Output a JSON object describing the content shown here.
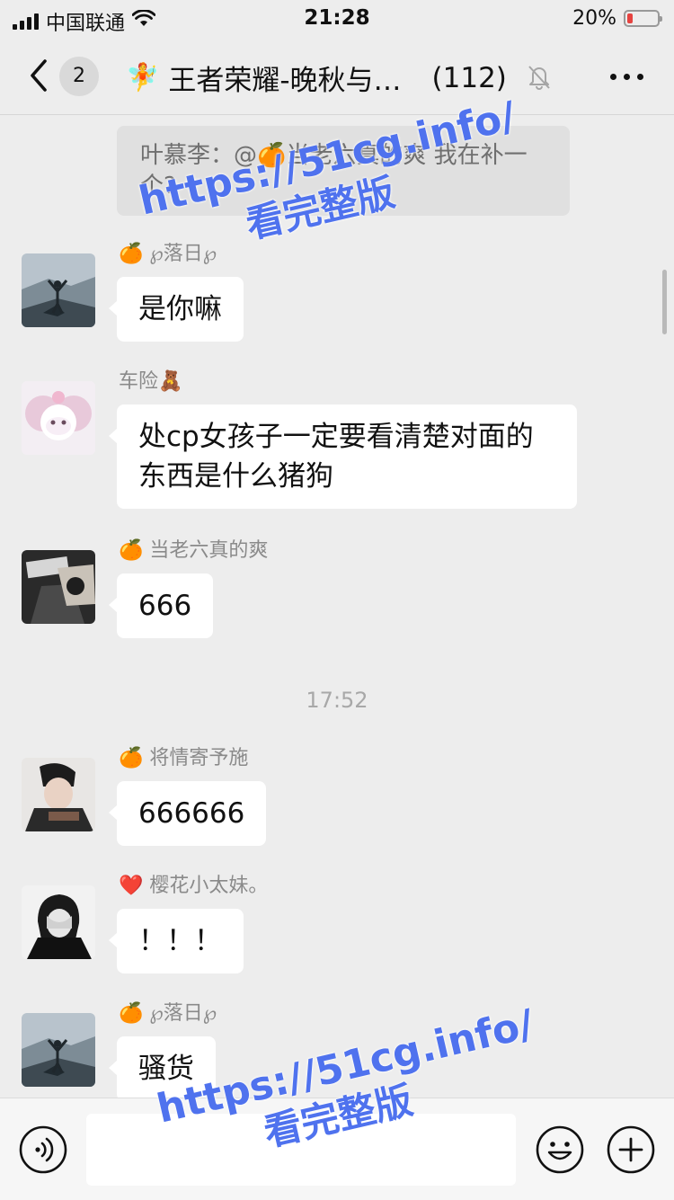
{
  "status_bar": {
    "carrier": "中国联通",
    "time": "21:28",
    "battery": "20%",
    "battery_level": 0.2,
    "battery_color": "#e64340"
  },
  "nav": {
    "unread_badge": "2",
    "title_icon": "fairy-emoji",
    "title_emoji": "🧚",
    "title": "王者荣耀-晚秋与…",
    "member_count": "(112)",
    "mute_icon": "muted-bell-icon",
    "more_icon": "ellipsis-icon"
  },
  "chat": {
    "quote_prefix": "🍊",
    "quote_text": "叶慕李：@🍊当老六真的爽 我在补一个?",
    "messages": [
      {
        "prefix": "🍊",
        "sender": "℘落日℘",
        "text": "是你嘛"
      },
      {
        "prefix": "",
        "sender": "车险🧸",
        "text": "处cp女孩子一定要看清楚对面的东西是什么猪狗"
      },
      {
        "prefix": "🍊",
        "sender": "当老六真的爽",
        "text": "666"
      },
      {
        "prefix": "🍊",
        "sender": "将情寄予施",
        "text": "666666"
      },
      {
        "prefix": "❤️",
        "sender": "樱花小太妹。",
        "text": "！！！"
      },
      {
        "prefix": "🍊",
        "sender": "℘落日℘",
        "text": "骚货"
      }
    ],
    "timestamp": "17:52"
  },
  "input_bar": {
    "voice_icon": "voice-icon",
    "emoji_icon": "smiley-icon",
    "plus_icon": "plus-circle-icon",
    "text_value": ""
  },
  "watermark": {
    "url": "https://51cg.info/",
    "caption": "看完整版",
    "color": "#4f72ee"
  }
}
